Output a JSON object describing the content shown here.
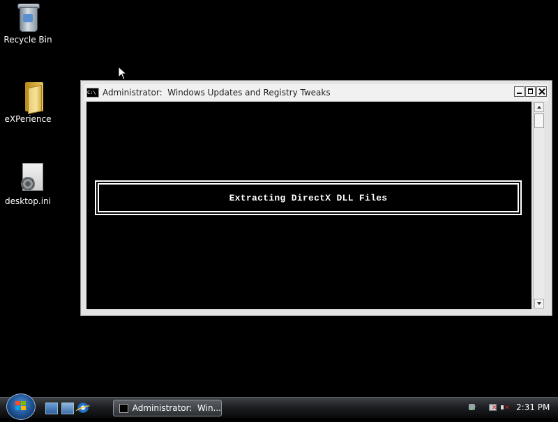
{
  "desktop": {
    "icons": [
      {
        "label": "Recycle Bin",
        "icon": "recycle-bin-icon"
      },
      {
        "label": "eXPerience",
        "icon": "folder-icon"
      },
      {
        "label": "desktop.ini",
        "icon": "settings-file-icon"
      }
    ]
  },
  "console": {
    "title": "Administrator:  Windows Updates and Registry Tweaks",
    "icon": "cmd-icon",
    "message": "Extracting DirectX DLL Files",
    "buttons": {
      "minimize": "minimize-icon",
      "maximize": "maximize-icon",
      "close": "close-icon"
    }
  },
  "taskbar": {
    "start": "windows-start-icon",
    "quick_launch": [
      "show-desktop-icon",
      "switch-windows-icon",
      "internet-explorer-icon"
    ],
    "task_button_label": "Administrator:  Win...",
    "tray_icons": [
      "windows-security-icon",
      "network-disconnected-icon",
      "volume-muted-icon"
    ],
    "clock": "2:31 PM"
  },
  "colors": {
    "desktop_background": "#000000",
    "console_background": "#000000",
    "console_text": "#ffffff",
    "window_frame": "#e4e4e4"
  }
}
